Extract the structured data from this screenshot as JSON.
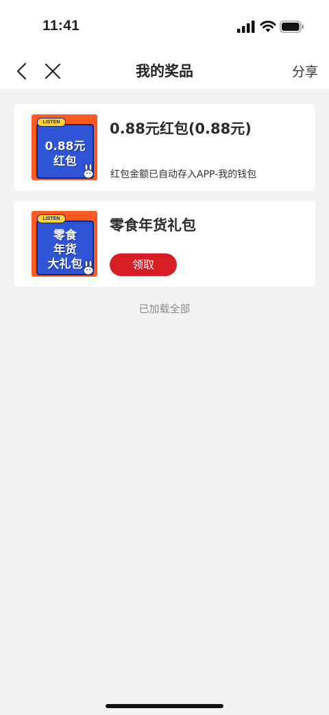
{
  "status": {
    "time": "11:41"
  },
  "nav": {
    "title": "我的奖品",
    "share_label": "分享"
  },
  "prizes": [
    {
      "title": "0.88元红包(0.88元)",
      "description": "红包金额已自动存入APP-我的钱包",
      "thumb_tag": "LISTEN",
      "thumb_text_lines": [
        "0.88元",
        "红包"
      ]
    },
    {
      "title": "零食年货礼包",
      "button_label": "领取",
      "thumb_tag": "LISTEN",
      "thumb_text_lines": [
        "零食",
        "年货",
        "大礼包"
      ]
    }
  ],
  "footer": {
    "loaded_text": "已加载全部"
  },
  "colors": {
    "accent_red": "#d81c26",
    "thumb_orange": "#ff5a22",
    "thumb_blue": "#2f55d6"
  }
}
